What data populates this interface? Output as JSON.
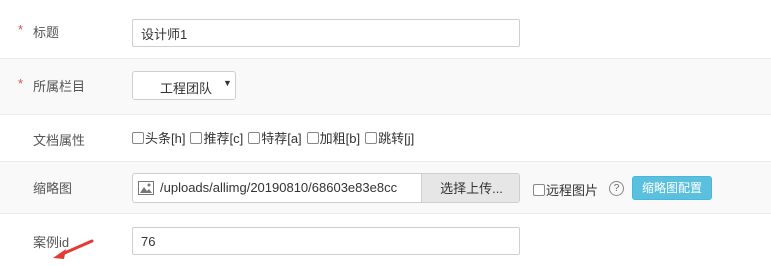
{
  "form": {
    "title": {
      "required_mark": "*",
      "label": "标题",
      "value": "设计师1"
    },
    "category": {
      "required_mark": "*",
      "label": "所属栏目",
      "selected": "工程团队"
    },
    "attributes": {
      "label": "文档属性",
      "options": [
        {
          "text": "头条[h]",
          "checked": false
        },
        {
          "text": "推荐[c]",
          "checked": false
        },
        {
          "text": "特荐[a]",
          "checked": false
        },
        {
          "text": "加粗[b]",
          "checked": false
        },
        {
          "text": "跳转[j]",
          "checked": false
        }
      ]
    },
    "thumbnail": {
      "label": "缩略图",
      "path": "/uploads/allimg/20190810/68603e83e8cc",
      "upload_button": "选择上传...",
      "remote_label": "远程图片",
      "help_icon": "?",
      "config_button": "缩略图配置"
    },
    "case_id": {
      "label": "案例id",
      "value": "76"
    }
  },
  "colors": {
    "required": "#d9534f",
    "config_button": "#5bc0de",
    "annotation_arrow": "#e53935"
  }
}
